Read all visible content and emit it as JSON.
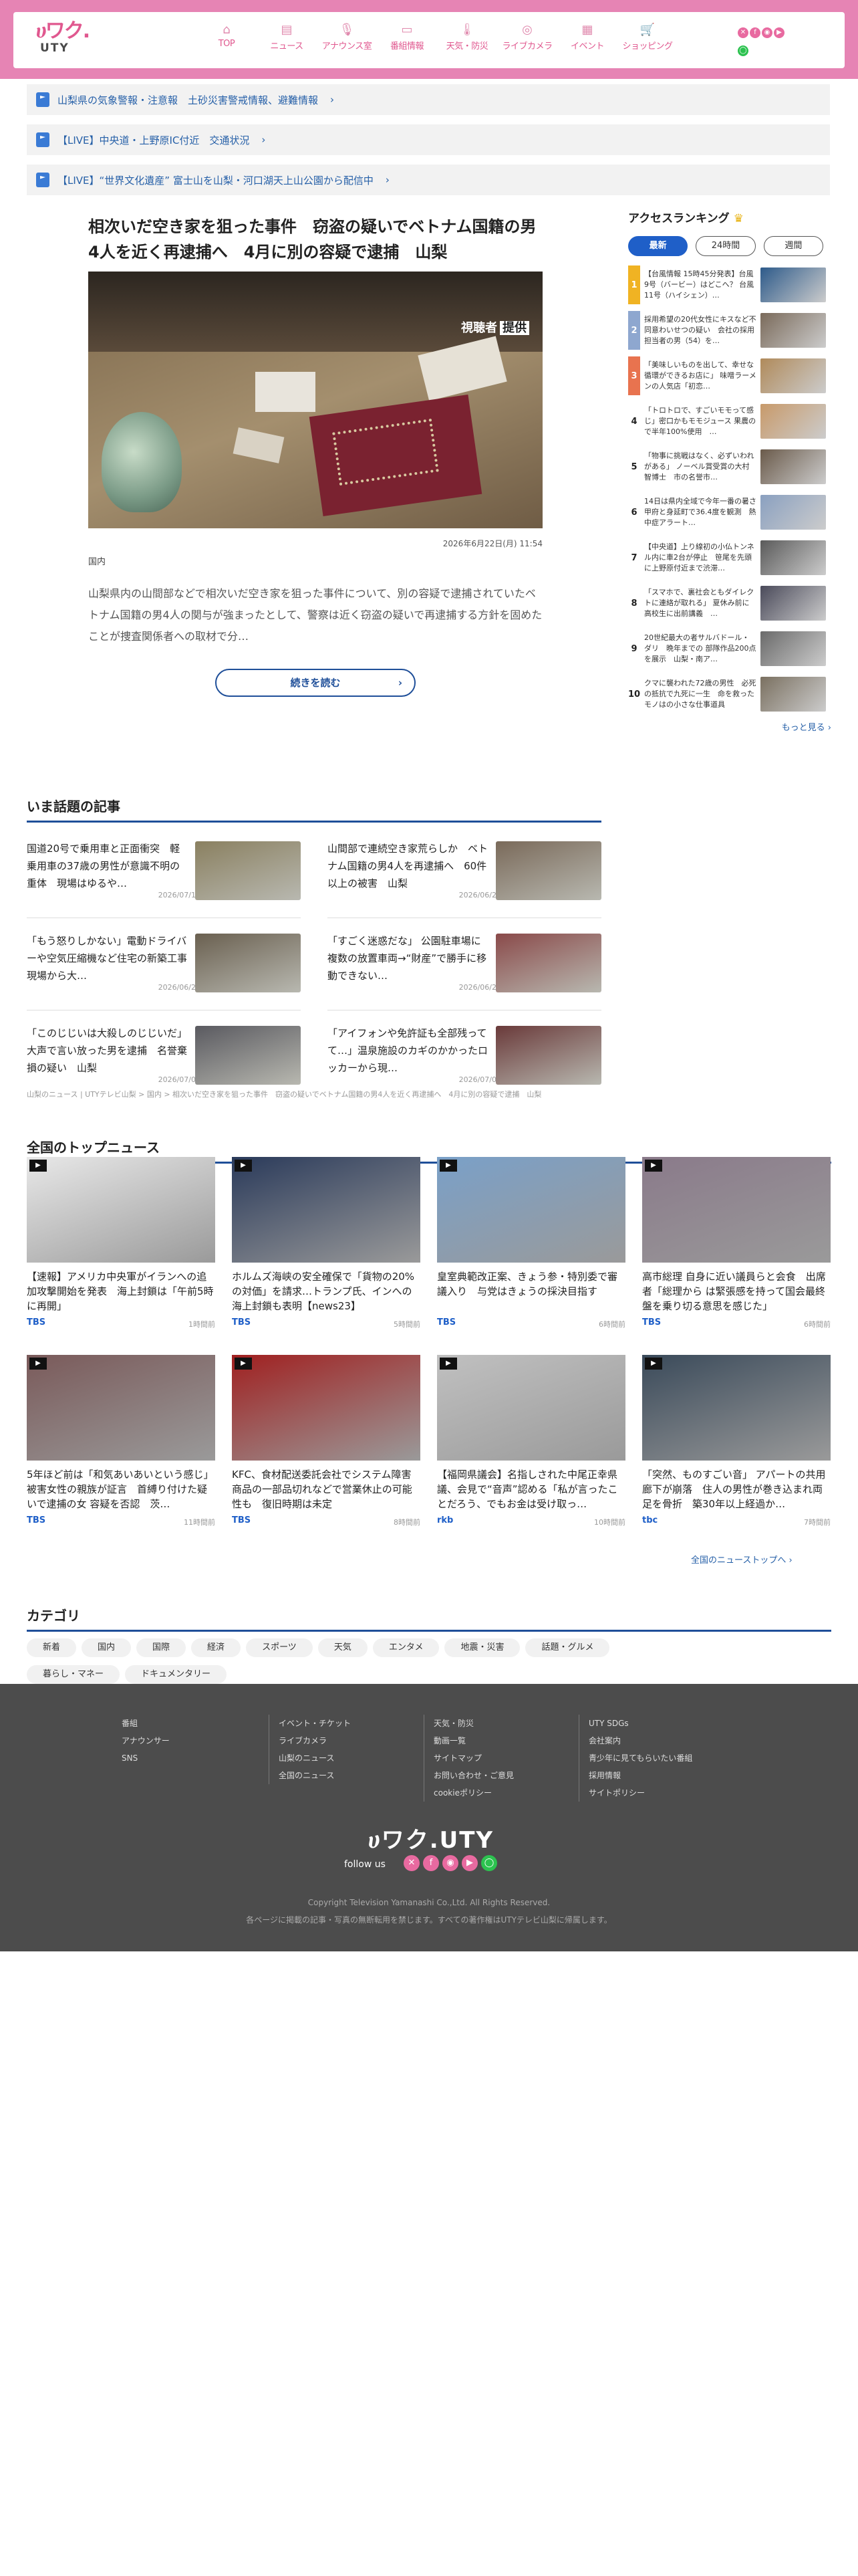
{
  "header": {
    "logo_main": "ሀワク.",
    "logo_sub": "UTY",
    "nav": [
      {
        "label": "TOP",
        "icon": "⌂"
      },
      {
        "label": "ニュース",
        "icon": "▤"
      },
      {
        "label": "アナウンス室",
        "icon": "🎙"
      },
      {
        "label": "番組情報",
        "icon": "▭"
      },
      {
        "label": "天気・防災",
        "icon": "🌡"
      },
      {
        "label": "ライブカメラ",
        "icon": "◎"
      },
      {
        "label": "イベント",
        "icon": "▦"
      },
      {
        "label": "ショッピング",
        "icon": "🛒"
      }
    ],
    "social": [
      {
        "icon": "x-icon",
        "glyph": "✕",
        "color": "#e86aa0"
      },
      {
        "icon": "facebook-icon",
        "glyph": "f",
        "color": "#e86aa0"
      },
      {
        "icon": "instagram-icon",
        "glyph": "◉",
        "color": "#e86aa0"
      },
      {
        "icon": "youtube-icon",
        "glyph": "▶",
        "color": "#e86aa0"
      },
      {
        "icon": "line-icon",
        "glyph": "◯",
        "color": "#2cc24f"
      }
    ]
  },
  "alerts": [
    "山梨県の気象警報・注意報　土砂災害警戒情報、避難情報",
    "【LIVE】中央道・上野原IC付近　交通状況",
    "【LIVE】“世界文化遺産” 富士山を山梨・河口湖天上山公園から配信中"
  ],
  "main": {
    "headline": "相次いだ空き家を狙った事件　窃盗の疑いでベトナム国籍の男4人を近く再逮捕へ　4月に別の容疑で逮捕　山梨",
    "photo_caption": "視聴者",
    "photo_caption_badge": "提供",
    "date": "2026年6月22日(月) 11:54",
    "category": "国内",
    "summary": "山梨県内の山間部などで相次いだ空き家を狙った事件について、別の容疑で逮捕されていたベトナム国籍の男4人の関与が強まったとして、警察は近く窃盗の疑いで再逮捕する方針を固めたことが捜査関係者への取材で分…",
    "more_label": "続きを読む"
  },
  "ranking": {
    "title": "アクセスランキング",
    "tabs": [
      "最新",
      "24時間",
      "週間"
    ],
    "active_tab": 0,
    "items": [
      {
        "rank": "1",
        "text": "【台風情報 15時45分発表】台風9号（バービー）はどこへ？ 台風11号（ハイシェン）…",
        "thumb": "#2d5a8a"
      },
      {
        "rank": "2",
        "text": "採用希望の20代女性にキスなど不同意わいせつの疑い　会社の採用担当者の男（54）を…",
        "thumb": "#7a6a5a"
      },
      {
        "rank": "3",
        "text": "「美味しいものを出して、幸せな循環ができるお店に」 味噌ラーメンの人気店「初恋…",
        "thumb": "#b08a5a"
      },
      {
        "rank": "4",
        "text": "「トロトロで、すごいモモって感じ」密口かもモモジュース 果農ので半年100%使用　…",
        "thumb": "#c89a6a"
      },
      {
        "rank": "5",
        "text": "「物事に挑戦はなく、必ずいわれがある」 ノーベル賞受賞の大村智博士　市の名誉市…",
        "thumb": "#6a5a4a"
      },
      {
        "rank": "6",
        "text": "14日は県内全域で今年一番の暑さ　甲府と身延町で36.4度を観測　熱中症アラート…",
        "thumb": "#8aa0c0"
      },
      {
        "rank": "7",
        "text": "【中央道】上り線初の小仏トンネル内に車2台が停止　笹尾を先頭に上野原付近まで渋滞…",
        "thumb": "#5a5a5a"
      },
      {
        "rank": "8",
        "text": "「スマホで、裏社会ともダイレクトに連絡が取れる」 夏休み前に高校生に出前講義　…",
        "thumb": "#4a4a5a"
      },
      {
        "rank": "9",
        "text": "20世紀最大の者サルバドール・ダリ　晩年までの 部隊作品200点を展示　山梨・南ア…",
        "thumb": "#6a6a6a"
      },
      {
        "rank": "10",
        "text": "クマに襲われた72歳の男性　必死の抵抗で九死に一生　命を救ったモノはの小さな仕事道具",
        "thumb": "#7a7060"
      }
    ],
    "more_label": "もっと見る"
  },
  "trending": {
    "title": "いま話題の記事",
    "items": [
      {
        "text": "国道20号で乗用車と正面衝突　軽乗用車の37歳の男性が意識不明の重体　現場はゆるや…",
        "date": "2026/07/10",
        "thumb": "#8a8060"
      },
      {
        "text": "山間部で連続空き家荒らしか　ベトナム国籍の男4人を再逮捕へ　60件以上の被害　山梨",
        "date": "2026/06/22",
        "thumb": "#7a6a5a"
      },
      {
        "text": "「もう怒りしかない」電動ドライバーや空気圧縮機など住宅の新築工事現場から大…",
        "date": "2026/06/24",
        "thumb": "#6a6050"
      },
      {
        "text": "「すごく迷惑だな」 公園駐車場に複数の放置車両→“財産”で勝手に移動できない…",
        "date": "2026/06/23",
        "thumb": "#8a4a4a"
      },
      {
        "text": "「このじじいは大殺しのじじいだ」 大声で言い放った男を逮捕　名誉棄損の疑い　山梨",
        "date": "2026/07/01",
        "thumb": "#5a5a60"
      },
      {
        "text": "「アイフォンや免許証も全部残ってて…」温泉施設のカギのかかったロッカーから現…",
        "date": "2026/07/05",
        "thumb": "#6a3a3a"
      }
    ]
  },
  "breadcrumb": "山梨のニュース | UTYテレビ山梨 > 国内 > 相次いだ空き家を狙った事件　窃盗の疑いでベトナム国籍の男4人を近く再逮捕へ　4月に別の容疑で逮捕　山梨",
  "top_news": {
    "title": "全国のトップニュース",
    "items": [
      {
        "text": "【速報】アメリカ中央軍がイランへの追加攻撃開始を発表　海上封鎖は「午前5時に再開」",
        "source": "TBS",
        "time": "1時間前",
        "thumb": "#e8e8e8"
      },
      {
        "text": "ホルムズ海峡の安全確保で「貨物の20%の対価」を請求…トランプ氏、インへの海上封鎖も表明【news23】",
        "source": "TBS",
        "time": "5時間前",
        "thumb": "#2a3a5a"
      },
      {
        "text": "皇室典範改正案、きょう参・特別委で審議入り　与党はきょうの採決目指す",
        "source": "TBS",
        "time": "6時間前",
        "thumb": "#7aa0c8"
      },
      {
        "text": "高市総理 自身に近い議員らと会食　出席者「総理から は緊張感を持って国会最終盤を乗り切る意思を感じた」",
        "source": "TBS",
        "time": "6時間前",
        "thumb": "#8a7a8a"
      },
      {
        "text": "5年ほど前は「和気あいあいという感じ」被害女性の親族が証言　首縛り付けた疑いで逮捕の女 容疑を否認　茨…",
        "source": "TBS",
        "time": "11時間前",
        "thumb": "#7a5a5a"
      },
      {
        "text": "KFC、食材配送委託会社でシステム障害　商品の一部品切れなどで営業休止の可能性も　復旧時期は未定",
        "source": "TBS",
        "time": "8時間前",
        "thumb": "#a02020"
      },
      {
        "text": "【福岡県議会】名指しされた中尾正幸県議、会見で“音声”認める「私が言ったことだろう、でもお金は受け取っ…",
        "source": "rkb",
        "time": "10時間前",
        "thumb": "#c0c0c0"
      },
      {
        "text": "「突然、ものすごい音」 アパートの共用廊下が崩落　住人の男性が巻き込まれ両足を骨折　築30年以上経過か…",
        "source": "tbc",
        "time": "7時間前",
        "thumb": "#3a4a5a"
      }
    ],
    "more_label": "全国のニューストップへ"
  },
  "categories": {
    "title": "カテゴリ",
    "items": [
      "新着",
      "国内",
      "国際",
      "経済",
      "スポーツ",
      "天気",
      "エンタメ",
      "地震・災害",
      "話題・グルメ",
      "暮らし・マネー",
      "ドキュメンタリー"
    ]
  },
  "footer": {
    "cols": [
      [
        "番組",
        "アナウンサー",
        "SNS"
      ],
      [
        "イベント・チケット",
        "ライブカメラ",
        "山梨のニュース",
        "全国のニュース"
      ],
      [
        "天気・防災",
        "動画一覧",
        "サイトマップ",
        "お問い合わせ・ご意見",
        "cookieポリシー"
      ],
      [
        "UTY SDGs",
        "会社案内",
        "青少年に見てもらいたい番組",
        "採用情報",
        "サイトポリシー"
      ]
    ],
    "logo": "ሀワク.UTY",
    "follow": "follow us",
    "copyright": "Copyright Television Yamanashi Co.,Ltd. All Rights Reserved.",
    "notice": "各ページに掲載の記事・写真の無断転用を禁じます。すべての著作権はUTYテレビ山梨に帰属します。"
  }
}
